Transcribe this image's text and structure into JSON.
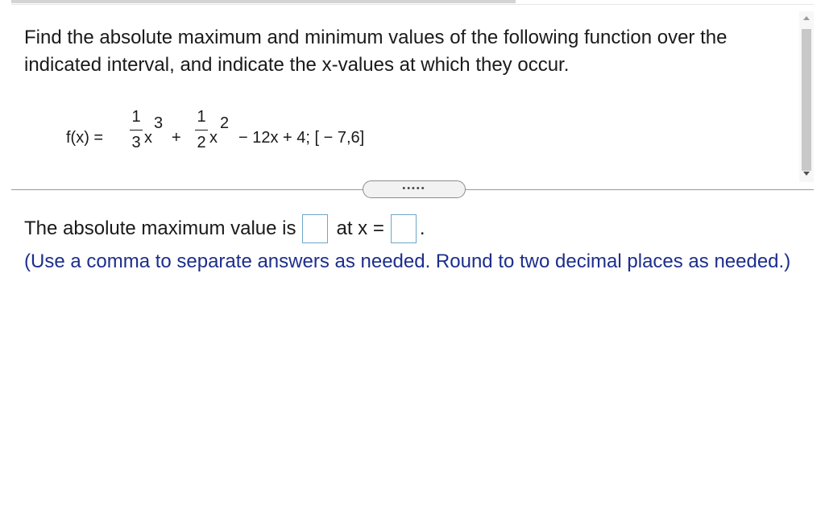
{
  "question": {
    "text": "Find the absolute maximum and minimum values of the following function over the indicated interval, and indicate the x-values at which they occur."
  },
  "formula": {
    "lhs": "f(x) =",
    "frac1_num": "1",
    "frac1_den": "3",
    "x1": "x",
    "exp1": "3",
    "plus": "+",
    "frac2_num": "1",
    "frac2_den": "2",
    "x2": "x",
    "exp2": "2",
    "tail": "− 12x + 4; [ − 7,6]"
  },
  "toggle": {
    "label": "•••••"
  },
  "answer": {
    "prefix": "The absolute maximum value is",
    "mid": "at x =",
    "suffix": ".",
    "value_box": "",
    "x_box": ""
  },
  "hint": "(Use a comma to separate answers as needed. Round to two decimal places as needed.)"
}
